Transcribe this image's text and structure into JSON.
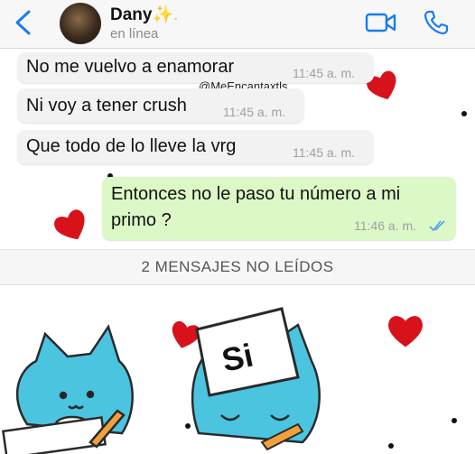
{
  "header": {
    "contact_name": "Dany",
    "name_suffix": "✨.",
    "status": "en línea",
    "icons": [
      "chevron-left-icon",
      "avatar",
      "video-call-icon",
      "phone-icon"
    ]
  },
  "watermark": "@MeEncantaxtls",
  "messages": [
    {
      "direction": "in",
      "text": "No me vuelvo a enamorar",
      "time": "11:45 a. m."
    },
    {
      "direction": "in",
      "text": "Ni voy a tener crush",
      "time": "11:45 a. m."
    },
    {
      "direction": "in",
      "text": "Que todo de lo lleve la vrg",
      "time": "11:45 a. m."
    },
    {
      "direction": "out",
      "text_line1": "Entonces no le paso tu número a mi",
      "text_line2": "primo ?",
      "time": "11:46 a. m.",
      "read": true
    }
  ],
  "unread_banner": "2 MENSAJES NO LEÍDOS",
  "sticker": {
    "sign_text": "Si"
  },
  "colors": {
    "accent": "#1a7cf0",
    "outgoing_bubble": "#dcf8c6",
    "incoming_bubble": "#f2f2f2",
    "heart": "#d8121b",
    "sticker_cat": "#4bc4e0"
  }
}
